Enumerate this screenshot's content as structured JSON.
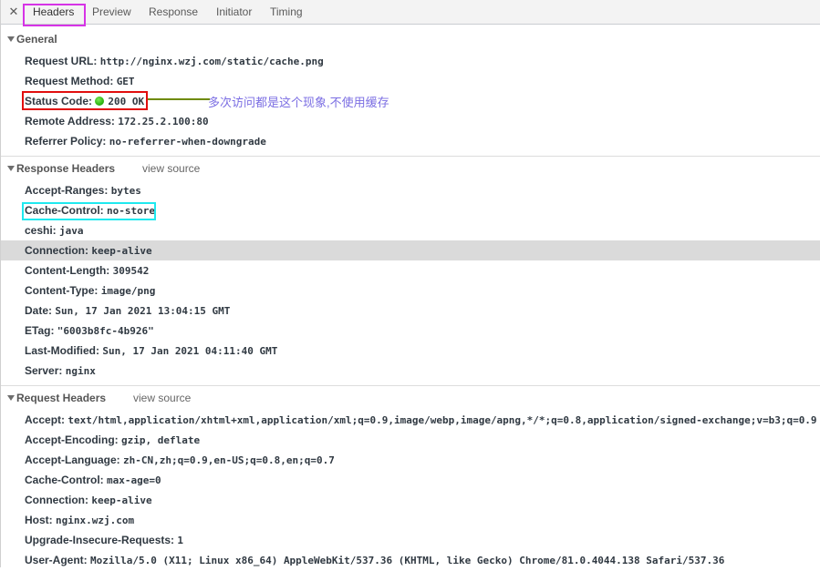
{
  "tabs": {
    "close_glyph": "✕",
    "items": [
      "Headers",
      "Preview",
      "Response",
      "Initiator",
      "Timing"
    ],
    "active": "Headers"
  },
  "general": {
    "title": "General",
    "rows": [
      {
        "key": "Request URL:",
        "value": "http://nginx.wzj.com/static/cache.png"
      },
      {
        "key": "Request Method:",
        "value": "GET"
      },
      {
        "key": "Status Code:",
        "value": "200 OK"
      },
      {
        "key": "Remote Address:",
        "value": "172.25.2.100:80"
      },
      {
        "key": "Referrer Policy:",
        "value": "no-referrer-when-downgrade"
      }
    ]
  },
  "annotation": {
    "text": "多次访问都是这个现象,不使用缓存",
    "color": "#7b6ee3",
    "line_color": "#6f8a08"
  },
  "response_headers": {
    "title": "Response Headers",
    "view_source": "view source",
    "rows": [
      {
        "key": "Accept-Ranges:",
        "value": "bytes"
      },
      {
        "key": "Cache-Control:",
        "value": "no-store"
      },
      {
        "key": "ceshi:",
        "value": "java"
      },
      {
        "key": "Connection:",
        "value": "keep-alive"
      },
      {
        "key": "Content-Length:",
        "value": "309542"
      },
      {
        "key": "Content-Type:",
        "value": "image/png"
      },
      {
        "key": "Date:",
        "value": "Sun, 17 Jan 2021 13:04:15 GMT"
      },
      {
        "key": "ETag:",
        "value": "\"6003b8fc-4b926\""
      },
      {
        "key": "Last-Modified:",
        "value": "Sun, 17 Jan 2021 04:11:40 GMT"
      },
      {
        "key": "Server:",
        "value": "nginx"
      }
    ]
  },
  "request_headers": {
    "title": "Request Headers",
    "view_source": "view source",
    "rows": [
      {
        "key": "Accept:",
        "value": "text/html,application/xhtml+xml,application/xml;q=0.9,image/webp,image/apng,*/*;q=0.8,application/signed-exchange;v=b3;q=0.9"
      },
      {
        "key": "Accept-Encoding:",
        "value": "gzip, deflate"
      },
      {
        "key": "Accept-Language:",
        "value": "zh-CN,zh;q=0.9,en-US;q=0.8,en;q=0.7"
      },
      {
        "key": "Cache-Control:",
        "value": "max-age=0"
      },
      {
        "key": "Connection:",
        "value": "keep-alive"
      },
      {
        "key": "Host:",
        "value": "nginx.wzj.com"
      },
      {
        "key": "Upgrade-Insecure-Requests:",
        "value": "1"
      },
      {
        "key": "User-Agent:",
        "value": "Mozilla/5.0 (X11; Linux x86_64) AppleWebKit/537.36 (KHTML, like Gecko) Chrome/81.0.4044.138 Safari/537.36"
      }
    ]
  },
  "colors": {
    "tab_highlight": "#d633e6",
    "status_box": "#e10e0e",
    "cache_control_box": "#1fe9ef",
    "status_dot": "#2fb512",
    "selected_row": "#dadada"
  }
}
